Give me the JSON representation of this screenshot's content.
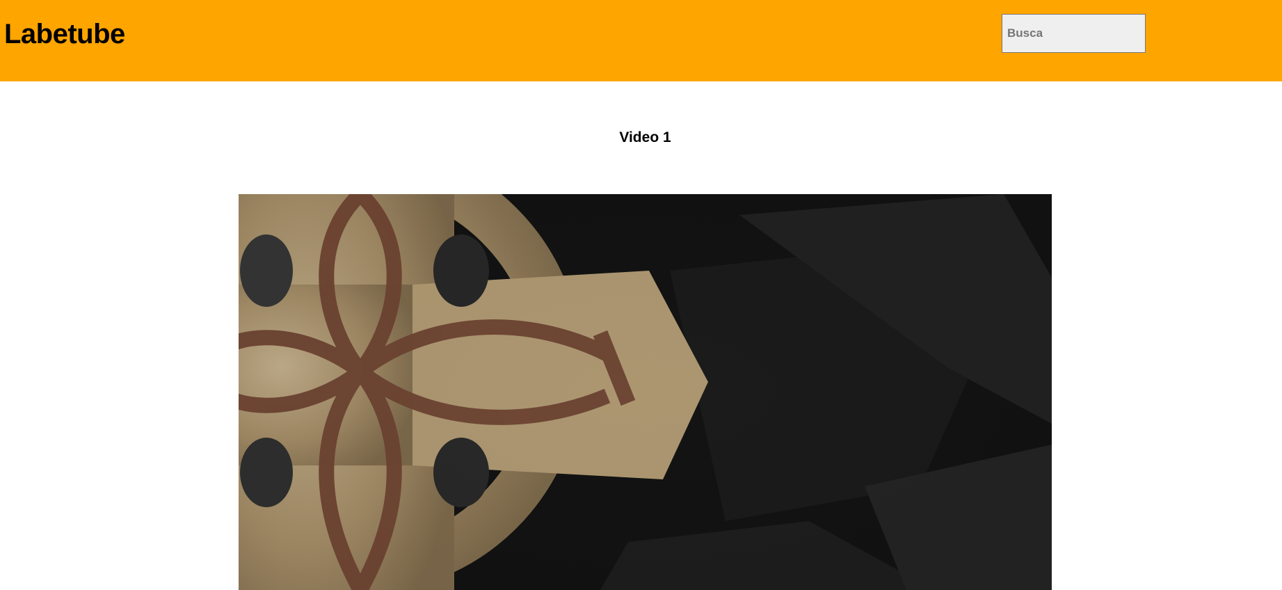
{
  "header": {
    "logo": "Labetube",
    "search": {
      "placeholder": "Busca",
      "value": ""
    }
  },
  "video": {
    "title": "Video 1",
    "thumbnail_icon": "celtic-cross-icon"
  },
  "colors": {
    "header_bg": "#ffa500",
    "page_bg": "#ffffff",
    "video_bg": "#111111"
  }
}
